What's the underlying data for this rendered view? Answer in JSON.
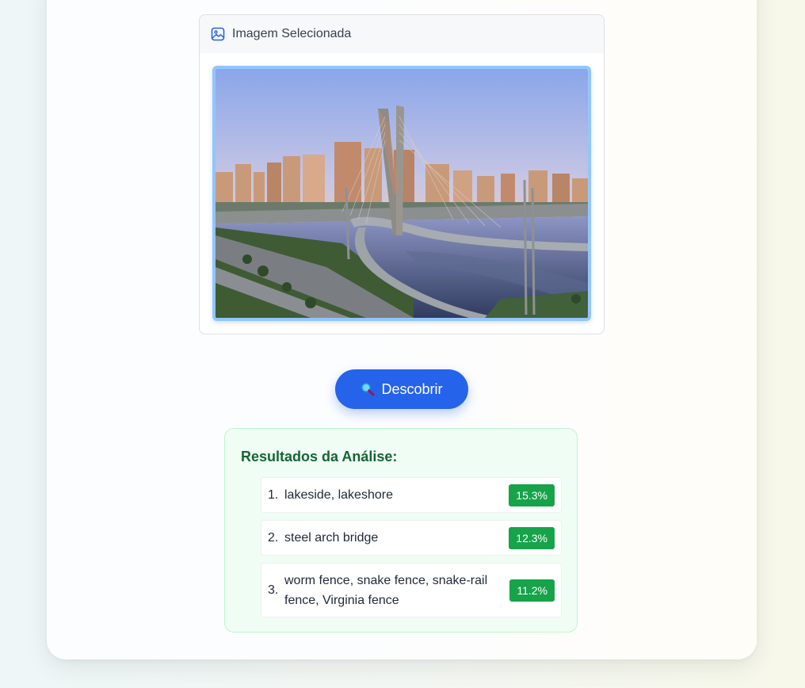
{
  "image_panel": {
    "title": "Imagem Selecionada",
    "icon": "image-icon"
  },
  "discover_button": {
    "label": "Descobrir",
    "icon": "magnifying-glass-icon",
    "color": "#2563eb"
  },
  "results": {
    "title": "Resultados da Análise:",
    "items": [
      {
        "rank": "1.",
        "label": "lakeside, lakeshore",
        "score": "15.3%"
      },
      {
        "rank": "2.",
        "label": "steel arch bridge",
        "score": "12.3%"
      },
      {
        "rank": "3.",
        "label": "worm fence, snake fence, snake-rail fence, Virginia fence",
        "score": "11.2%"
      }
    ],
    "badge_color": "#16a34a"
  }
}
